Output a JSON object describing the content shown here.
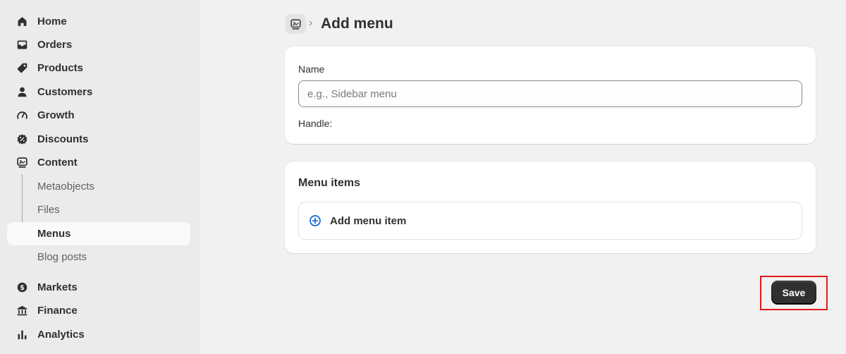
{
  "sidebar": {
    "items": [
      {
        "label": "Home",
        "icon": "home-icon"
      },
      {
        "label": "Orders",
        "icon": "inbox-icon"
      },
      {
        "label": "Products",
        "icon": "tag-icon"
      },
      {
        "label": "Customers",
        "icon": "person-icon"
      },
      {
        "label": "Growth",
        "icon": "gauge-icon"
      },
      {
        "label": "Discounts",
        "icon": "discount-icon"
      },
      {
        "label": "Content",
        "icon": "content-icon"
      }
    ],
    "content_subitems": [
      {
        "label": "Metaobjects"
      },
      {
        "label": "Files"
      },
      {
        "label": "Menus",
        "active": true
      },
      {
        "label": "Blog posts"
      }
    ],
    "bottom_items": [
      {
        "label": "Markets",
        "icon": "globe-dollar-icon"
      },
      {
        "label": "Finance",
        "icon": "bank-icon"
      },
      {
        "label": "Analytics",
        "icon": "bar-chart-icon"
      }
    ]
  },
  "header": {
    "breadcrumb_icon": "content-icon",
    "separator": "›",
    "title": "Add menu"
  },
  "name_card": {
    "name_label": "Name",
    "name_placeholder": "e.g., Sidebar menu",
    "name_value": "",
    "handle_label": "Handle:"
  },
  "menu_card": {
    "title": "Menu items",
    "add_label": "Add menu item",
    "add_icon": "plus-circle-icon"
  },
  "actions": {
    "save_label": "Save"
  },
  "colors": {
    "accent": "#005bd3",
    "primary_button": "#303030",
    "highlight": "#e01b1b"
  }
}
